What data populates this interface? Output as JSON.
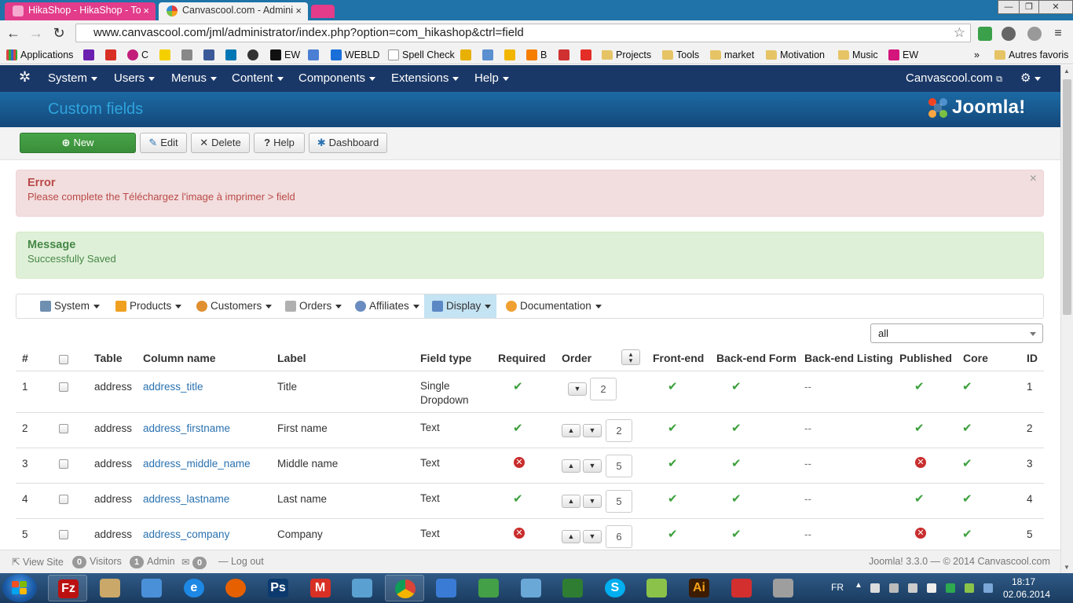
{
  "browser": {
    "tabs": [
      {
        "label": "HikaShop - HikaShop - To",
        "active": false
      },
      {
        "label": "Canvascool.com - Admini",
        "active": true
      }
    ],
    "url": "www.canvascool.com/jml/administrator/index.php?option=com_hikashop&ctrl=field",
    "window_controls": {
      "minimize": "—",
      "maximize": "❐",
      "close": "✕"
    },
    "bookmarks": [
      {
        "label": "Applications",
        "icon": "apps-grid-icon"
      },
      {
        "label": "",
        "icon": "yahoo-icon"
      },
      {
        "label": "",
        "icon": "gmail-icon"
      },
      {
        "label": "C",
        "icon": "c-icon"
      },
      {
        "label": "",
        "icon": "note-icon"
      },
      {
        "label": "",
        "icon": "tool-icon"
      },
      {
        "label": "",
        "icon": "facebook-icon"
      },
      {
        "label": "",
        "icon": "linkedin-icon"
      },
      {
        "label": "",
        "icon": "gear-icon"
      },
      {
        "label": "EW",
        "icon": "e-icon"
      },
      {
        "label": "",
        "icon": "translate-icon"
      },
      {
        "label": "WEBLD",
        "icon": "webld-icon"
      },
      {
        "label": "Spell Check",
        "icon": "page-icon"
      },
      {
        "label": "",
        "icon": "bar-icon"
      },
      {
        "label": "",
        "icon": "check-icon"
      },
      {
        "label": "",
        "icon": "rss-icon"
      },
      {
        "label": "B",
        "icon": "blogger-icon"
      },
      {
        "label": "",
        "icon": "chart-icon"
      },
      {
        "label": "",
        "icon": "youtube-icon"
      },
      {
        "label": "Projects",
        "icon": "folder-icon"
      },
      {
        "label": "Tools",
        "icon": "folder-icon"
      },
      {
        "label": "market",
        "icon": "folder-icon"
      },
      {
        "label": "Motivation",
        "icon": "folder-icon"
      },
      {
        "label": "Music",
        "icon": "folder-icon"
      },
      {
        "label": "EW",
        "icon": "elementor-icon"
      }
    ],
    "bookmarks_more": "»",
    "other_bookmarks": "Autres favoris"
  },
  "joomla": {
    "menu": [
      "System",
      "Users",
      "Menus",
      "Content",
      "Components",
      "Extensions",
      "Help"
    ],
    "site_link": "Canvascool.com",
    "page_title": "Custom fields",
    "logo_text": "Joomla!"
  },
  "toolbar": {
    "new": "New",
    "edit": "Edit",
    "delete": "Delete",
    "help": "Help",
    "dashboard": "Dashboard"
  },
  "alerts": {
    "error_title": "Error",
    "error_body": "Please complete the Téléchargez l'image à imprimer > field",
    "close": "×",
    "message_title": "Message",
    "message_body": "Successfully Saved"
  },
  "submenu": [
    {
      "label": "System",
      "icon": "tools-icon",
      "active": false
    },
    {
      "label": "Products",
      "icon": "products-icon",
      "active": false
    },
    {
      "label": "Customers",
      "icon": "customers-icon",
      "active": false
    },
    {
      "label": "Orders",
      "icon": "orders-icon",
      "active": false
    },
    {
      "label": "Affiliates",
      "icon": "affiliates-icon",
      "active": false
    },
    {
      "label": "Display",
      "icon": "display-icon",
      "active": true
    },
    {
      "label": "Documentation",
      "icon": "documentation-icon",
      "active": false
    }
  ],
  "filter": {
    "selected": "all"
  },
  "table": {
    "headers": {
      "num": "#",
      "table": "Table",
      "column": "Column name",
      "label": "Label",
      "type": "Field type",
      "required": "Required",
      "order": "Order",
      "frontend": "Front-end",
      "backend_form": "Back-end Form",
      "backend_listing": "Back-end Listing",
      "published": "Published",
      "core": "Core",
      "id": "ID"
    },
    "rows": [
      {
        "num": "1",
        "table": "address",
        "column": "address_title",
        "label": "Title",
        "type_l1": "Single",
        "type_l2": "Dropdown",
        "required": true,
        "order": "2",
        "frontend": true,
        "backend_form": true,
        "backend_listing": "--",
        "published": true,
        "core": true,
        "id": "1"
      },
      {
        "num": "2",
        "table": "address",
        "column": "address_firstname",
        "label": "First name",
        "type_l1": "Text",
        "type_l2": "",
        "required": true,
        "order": "2",
        "frontend": true,
        "backend_form": true,
        "backend_listing": "--",
        "published": true,
        "core": true,
        "id": "2"
      },
      {
        "num": "3",
        "table": "address",
        "column": "address_middle_name",
        "label": "Middle name",
        "type_l1": "Text",
        "type_l2": "",
        "required": false,
        "order": "5",
        "frontend": true,
        "backend_form": true,
        "backend_listing": "--",
        "published": false,
        "core": true,
        "id": "3"
      },
      {
        "num": "4",
        "table": "address",
        "column": "address_lastname",
        "label": "Last name",
        "type_l1": "Text",
        "type_l2": "",
        "required": true,
        "order": "5",
        "frontend": true,
        "backend_form": true,
        "backend_listing": "--",
        "published": true,
        "core": true,
        "id": "4"
      },
      {
        "num": "5",
        "table": "address",
        "column": "address_company",
        "label": "Company",
        "type_l1": "Text",
        "type_l2": "",
        "required": false,
        "order": "6",
        "frontend": true,
        "backend_form": true,
        "backend_listing": "--",
        "published": false,
        "core": true,
        "id": "5"
      }
    ]
  },
  "statusbar": {
    "view_site": "View Site",
    "visitors_count": "0",
    "visitors": "Visitors",
    "admin_count": "1",
    "admin": "Admin",
    "messages_count": "0",
    "logout": "Log out",
    "footer": "Joomla! 3.3.0  —  © 2014 Canvascool.com"
  },
  "taskbar": {
    "apps": [
      "filezilla",
      "explorer",
      "user",
      "ie",
      "firefox",
      "photoshop",
      "gmail",
      "news",
      "chrome",
      "scanner",
      "calculator-grid",
      "notes",
      "downloads",
      "skype",
      "money",
      "illustrator",
      "acrobat",
      "calculator"
    ],
    "lang": "FR",
    "time": "18:17",
    "date": "02.06.2014"
  },
  "colors": {
    "joomla_menu": "#1a3867",
    "joomla_header": "#17568c",
    "success_green": "#3ca03c",
    "error_red": "#c92d2d",
    "link_blue": "#2a72b0"
  }
}
